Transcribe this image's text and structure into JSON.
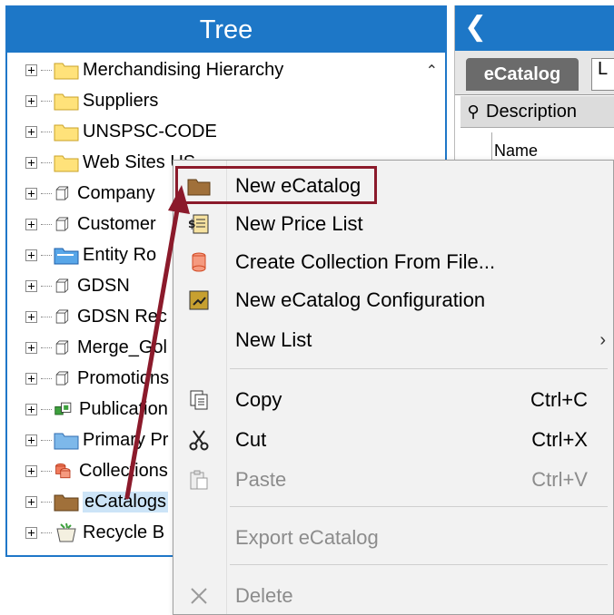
{
  "tree": {
    "title": "Tree",
    "items": [
      {
        "label": "Merchandising Hierarchy",
        "icon": "yellow-folder-icon"
      },
      {
        "label": "Suppliers",
        "icon": "yellow-folder-icon"
      },
      {
        "label": "UNSPSC-CODE",
        "icon": "yellow-folder-icon"
      },
      {
        "label": "Web Sites US",
        "icon": "yellow-folder-icon"
      },
      {
        "label": "Company",
        "icon": "cube-icon"
      },
      {
        "label": "Customer",
        "icon": "cube-icon"
      },
      {
        "label": "Entity Ro",
        "icon": "blue-folder-icon"
      },
      {
        "label": "GDSN",
        "icon": "cube-icon"
      },
      {
        "label": "GDSN Rec",
        "icon": "cube-icon"
      },
      {
        "label": "Merge_Gol",
        "icon": "cube-icon"
      },
      {
        "label": "Promotions",
        "icon": "cube-icon"
      },
      {
        "label": "Publication",
        "icon": "green-cubes-icon"
      },
      {
        "label": "Primary Pr",
        "icon": "blue-folder-icon"
      },
      {
        "label": "Collections",
        "icon": "red-cylinders-icon"
      },
      {
        "label": "eCatalogs",
        "icon": "brown-folder-icon"
      },
      {
        "label": "Recycle B",
        "icon": "recycle-bin-icon"
      }
    ]
  },
  "right_panel": {
    "tab_active": "eCatalog",
    "tab_other": "L",
    "column_header": "Description",
    "row_label": "Name"
  },
  "context_menu": {
    "items": [
      {
        "label": "New eCatalog",
        "icon": "brown-folder-icon"
      },
      {
        "label": "New Price List",
        "icon": "price-list-icon"
      },
      {
        "label": "Create Collection From File...",
        "icon": "red-cylinder-icon"
      },
      {
        "label": "New eCatalog Configuration",
        "icon": "config-icon"
      },
      {
        "label": "New List",
        "has_submenu": true
      },
      {
        "label": "Copy",
        "shortcut": "Ctrl+C",
        "icon": "copy-icon"
      },
      {
        "label": "Cut",
        "shortcut": "Ctrl+X",
        "icon": "scissors-icon"
      },
      {
        "label": "Paste",
        "shortcut": "Ctrl+V",
        "icon": "paste-icon",
        "disabled": true
      },
      {
        "label": "Export eCatalog",
        "disabled": true
      },
      {
        "label": "Delete",
        "icon": "delete-x-icon",
        "disabled": true
      }
    ]
  },
  "colors": {
    "header_blue": "#1d77c7",
    "annotation_red": "#8b1a2b",
    "selection_blue": "#cce4f7"
  }
}
